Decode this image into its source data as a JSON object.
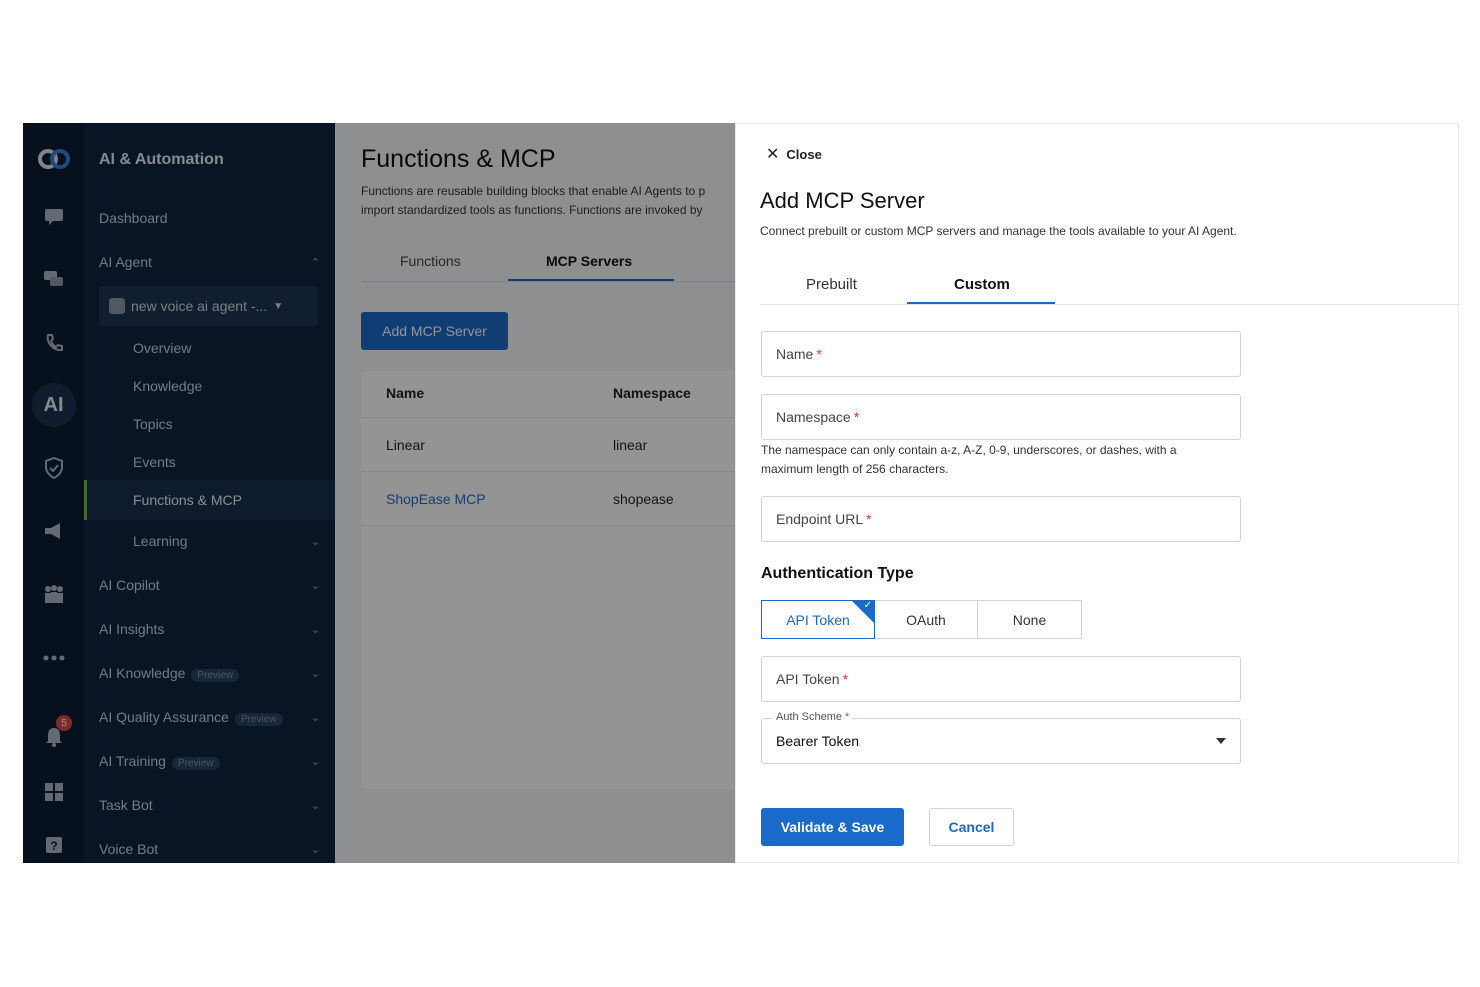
{
  "nav": {
    "app_title": "AI & Automation",
    "items": {
      "dashboard": "Dashboard",
      "ai_agent": "AI Agent",
      "agent_select": "new voice ai agent -...",
      "overview": "Overview",
      "knowledge": "Knowledge",
      "topics": "Topics",
      "events": "Events",
      "functions_mcp": "Functions & MCP",
      "learning": "Learning",
      "ai_copilot": "AI Copilot",
      "ai_insights": "AI Insights",
      "ai_knowledge": "AI Knowledge",
      "ai_quality": "AI Quality Assurance",
      "ai_training": "AI Training",
      "task_bot": "Task Bot",
      "voice_bot": "Voice Bot"
    },
    "preview_tag": "Preview",
    "notification_count": "5",
    "active_icon_text": "AI"
  },
  "main": {
    "title": "Functions & MCP",
    "description_line1": "Functions are reusable building blocks that enable AI Agents to p",
    "description_line2": "import standardized tools as functions. Functions are invoked by",
    "tabs": [
      "Functions",
      "MCP Servers"
    ],
    "add_button": "Add MCP Server",
    "columns": [
      "Name",
      "Namespace"
    ],
    "rows": [
      {
        "name": "Linear",
        "namespace": "linear"
      },
      {
        "name": "ShopEase MCP",
        "namespace": "shopease"
      }
    ]
  },
  "drawer": {
    "close_label": "Close",
    "title": "Add MCP Server",
    "subtitle": "Connect prebuilt or custom MCP servers and manage the tools available to your AI Agent.",
    "tabs": [
      "Prebuilt",
      "Custom"
    ],
    "fields": {
      "name_placeholder": "Name",
      "namespace_placeholder": "Namespace",
      "namespace_hint": "The namespace can only contain a-z, A-Z, 0-9, underscores, or dashes, with a maximum length of 256 characters.",
      "endpoint_placeholder": "Endpoint URL",
      "required_mark": "*"
    },
    "auth": {
      "section_title": "Authentication Type",
      "options": [
        "API Token",
        "OAuth",
        "None"
      ],
      "selected": "API Token",
      "api_token_placeholder": "API Token",
      "scheme_label": "Auth Scheme",
      "scheme_value": "Bearer Token"
    },
    "buttons": {
      "save": "Validate & Save",
      "cancel": "Cancel"
    }
  },
  "colors": {
    "accent": "#1a6ac9",
    "rail_bg": "#0d1e33",
    "nav_bg": "#102540",
    "active_indicator": "#7fb84a",
    "required": "#d63a3a"
  }
}
